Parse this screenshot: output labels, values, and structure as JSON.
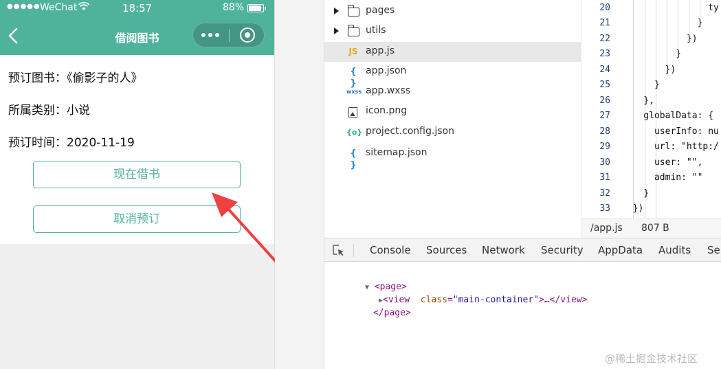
{
  "simulator": {
    "status_bar": {
      "signal": "●●●●●",
      "carrier": "WeChat",
      "wifi_icon": "wifi-icon",
      "time": "18:57",
      "battery_percent": "88%",
      "battery_level": 0.88
    },
    "nav_bar": {
      "title": "借阅图书",
      "back_icon": "chevron-left-icon",
      "capsule_icons": [
        "more-dots-icon",
        "close-target-icon"
      ]
    },
    "fields": [
      {
        "label": "预订图书：",
        "value": "《偷影子的人》"
      },
      {
        "label": "所属类别：",
        "value": "小说"
      },
      {
        "label": "预订时间：",
        "value": "2020-11-19"
      }
    ],
    "buttons": {
      "borrow_now": "现在借书",
      "cancel_reservation": "取消预订"
    },
    "accent_color": "#4fb39c",
    "annotation_arrow_color": "#f04141"
  },
  "file_tree": {
    "items": [
      {
        "name": "pages",
        "type": "folder",
        "icon": "folder-icon"
      },
      {
        "name": "utils",
        "type": "folder",
        "icon": "folder-icon"
      },
      {
        "name": "app.js",
        "type": "js",
        "icon_text": "JS",
        "selected": true
      },
      {
        "name": "app.json",
        "type": "json",
        "icon_text": "{ }"
      },
      {
        "name": "app.wxss",
        "type": "wxss",
        "icon_text": "wxss"
      },
      {
        "name": "icon.png",
        "type": "image",
        "icon": "image-file-icon"
      },
      {
        "name": "project.config.json",
        "type": "config",
        "icon_text": "{o}"
      },
      {
        "name": "sitemap.json",
        "type": "json",
        "icon_text": "{ }"
      }
    ]
  },
  "editor": {
    "lines": [
      {
        "n": "20",
        "text": "                ty"
      },
      {
        "n": "21",
        "text": "              }"
      },
      {
        "n": "22",
        "text": "            })"
      },
      {
        "n": "23",
        "text": "          }"
      },
      {
        "n": "24",
        "text": "        })"
      },
      {
        "n": "25",
        "text": "      }"
      },
      {
        "n": "26",
        "text": "    },"
      },
      {
        "n": "27",
        "text": "    globalData: {"
      },
      {
        "n": "28",
        "text": "      userInfo: nu"
      },
      {
        "n": "29",
        "text": "      url: \"http:/"
      },
      {
        "n": "30",
        "text": "      user: \"\","
      },
      {
        "n": "31",
        "text": "      admin: \"\""
      },
      {
        "n": "32",
        "text": "    }"
      },
      {
        "n": "33",
        "text": "  })"
      }
    ],
    "status": {
      "file": "/app.js",
      "size": "807 B"
    }
  },
  "devtools": {
    "tabs": [
      "Console",
      "Sources",
      "Network",
      "Security",
      "AppData",
      "Audits",
      "Ser"
    ],
    "dom": {
      "open_tag": "<page>",
      "child_tag_start": "<view",
      "child_attr_name": "class",
      "child_attr_value": "\"main-container\"",
      "child_tag_end": ">…</view>",
      "close_tag": "</page>"
    }
  },
  "watermark": "@稀土掘金技术社区"
}
